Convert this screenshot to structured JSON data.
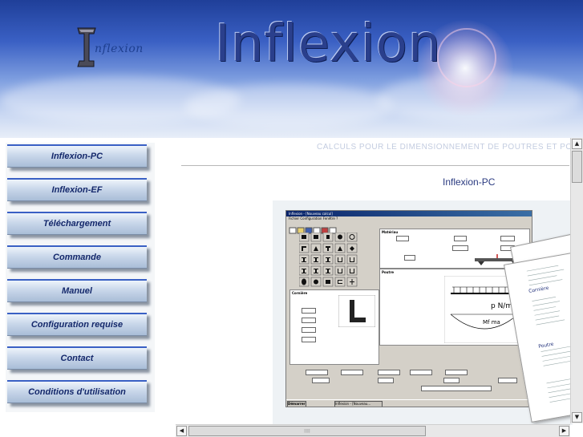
{
  "header": {
    "logo_text": "nflexion",
    "site_title": "Inflexion"
  },
  "menu": {
    "items": [
      {
        "label": "Inflexion-PC"
      },
      {
        "label": "Inflexion-EF"
      },
      {
        "label": "Téléchargement"
      },
      {
        "label": "Commande"
      },
      {
        "label": "Manuel"
      },
      {
        "label": "Configuration requise"
      },
      {
        "label": "Contact"
      },
      {
        "label": "Conditions d'utilisation"
      }
    ]
  },
  "main": {
    "tagline": "CALCULS POUR LE DIMENSIONNEMENT DE POUTRES ET PORTIQUES",
    "section_title": "Inflexion-PC"
  },
  "screenshot": {
    "window_title": "Inflexion - [Nouveau calcul]",
    "menu_bar": "Fichier   Configuration   Fenêtre   ?",
    "material_label": "Matériau",
    "beam_label": "Poutre",
    "section_label": "Cornière",
    "start_label": "Démarrer",
    "taskbar_item": "Inflexion - [Nouveau...",
    "load_label": "p N/m",
    "moment_label": "Mf ma",
    "paper_title": "Cornière",
    "paper_beam": "Poutre"
  },
  "scrollbar": {
    "up_icon": "▲",
    "down_icon": "▼",
    "left_icon": "◀",
    "right_icon": "▶",
    "grip": "⁞⁞⁞⁞"
  },
  "colors": {
    "banner_top": "#1f3f99",
    "menu_text": "#14286b",
    "title_text": "#2a3f8c"
  }
}
